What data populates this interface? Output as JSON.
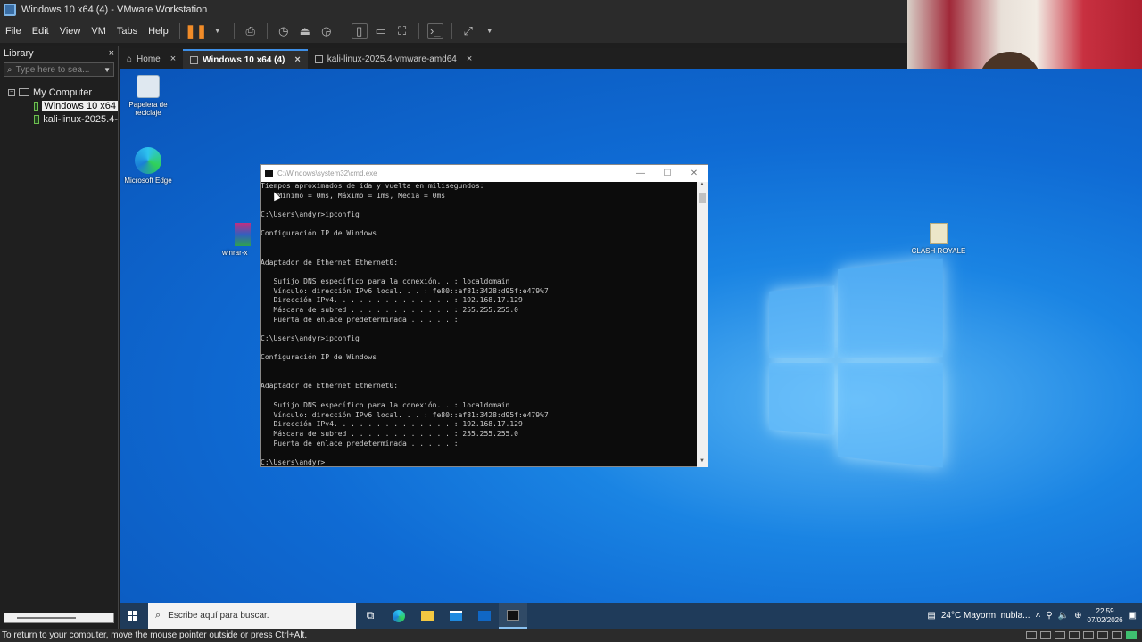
{
  "window": {
    "title": "Windows 10 x64 (4) - VMware Workstation"
  },
  "menu": [
    "File",
    "Edit",
    "View",
    "VM",
    "Tabs",
    "Help"
  ],
  "library": {
    "title": "Library",
    "close": "×",
    "search_placeholder": "Type here to sea...",
    "tree": {
      "root": "My Computer",
      "vms": [
        "Windows 10 x64",
        "kali-linux-2025.4-"
      ]
    }
  },
  "tabs": [
    {
      "label": "Home",
      "close": "×"
    },
    {
      "label": "Windows 10 x64 (4)",
      "close": "×"
    },
    {
      "label": "kali-linux-2025.4-vmware-amd64",
      "close": "×"
    }
  ],
  "desktop_icons": {
    "recycle": "Papelera de reciclaje",
    "edge": "Microsoft Edge",
    "winrar": "winrar-x",
    "clash": "CLASH ROYALE"
  },
  "cmd": {
    "title": "C:\\Windows\\system32\\cmd.exe",
    "lines": [
      "Tiempos aproximados de ida y vuelta en milisegundos:",
      "    Mínimo = 0ms, Máximo = 1ms, Media = 0ms",
      "",
      "C:\\Users\\andyr>ipconfig",
      "",
      "Configuración IP de Windows",
      "",
      "",
      "Adaptador de Ethernet Ethernet0:",
      "",
      "   Sufijo DNS específico para la conexión. . : localdomain",
      "   Vínculo: dirección IPv6 local. . . : fe80::af81:3428:d95f:e479%7",
      "   Dirección IPv4. . . . . . . . . . . . . . : 192.168.17.129",
      "   Máscara de subred . . . . . . . . . . . . : 255.255.255.0",
      "   Puerta de enlace predeterminada . . . . . :",
      "",
      "C:\\Users\\andyr>ipconfig",
      "",
      "Configuración IP de Windows",
      "",
      "",
      "Adaptador de Ethernet Ethernet0:",
      "",
      "   Sufijo DNS específico para la conexión. . : localdomain",
      "   Vínculo: dirección IPv6 local. . . : fe80::af81:3428:d95f:e479%7",
      "   Dirección IPv4. . . . . . . . . . . . . . : 192.168.17.129",
      "   Máscara de subred . . . . . . . . . . . . : 255.255.255.0",
      "   Puerta de enlace predeterminada . . . . . :",
      "",
      "C:\\Users\\andyr>"
    ]
  },
  "taskbar": {
    "search_placeholder": "Escribe aquí para buscar.",
    "weather": "24°C  Mayorm. nubla...",
    "time": "22:59",
    "date": "07/02/2026"
  },
  "statusbar": {
    "text": "To return to your computer, move the mouse pointer outside or press Ctrl+Alt."
  },
  "colors": {
    "accent": "#3d8ee6",
    "pause": "#f28c28",
    "desktop": "#0f6bd4",
    "taskbar": "#1f3b5a"
  }
}
